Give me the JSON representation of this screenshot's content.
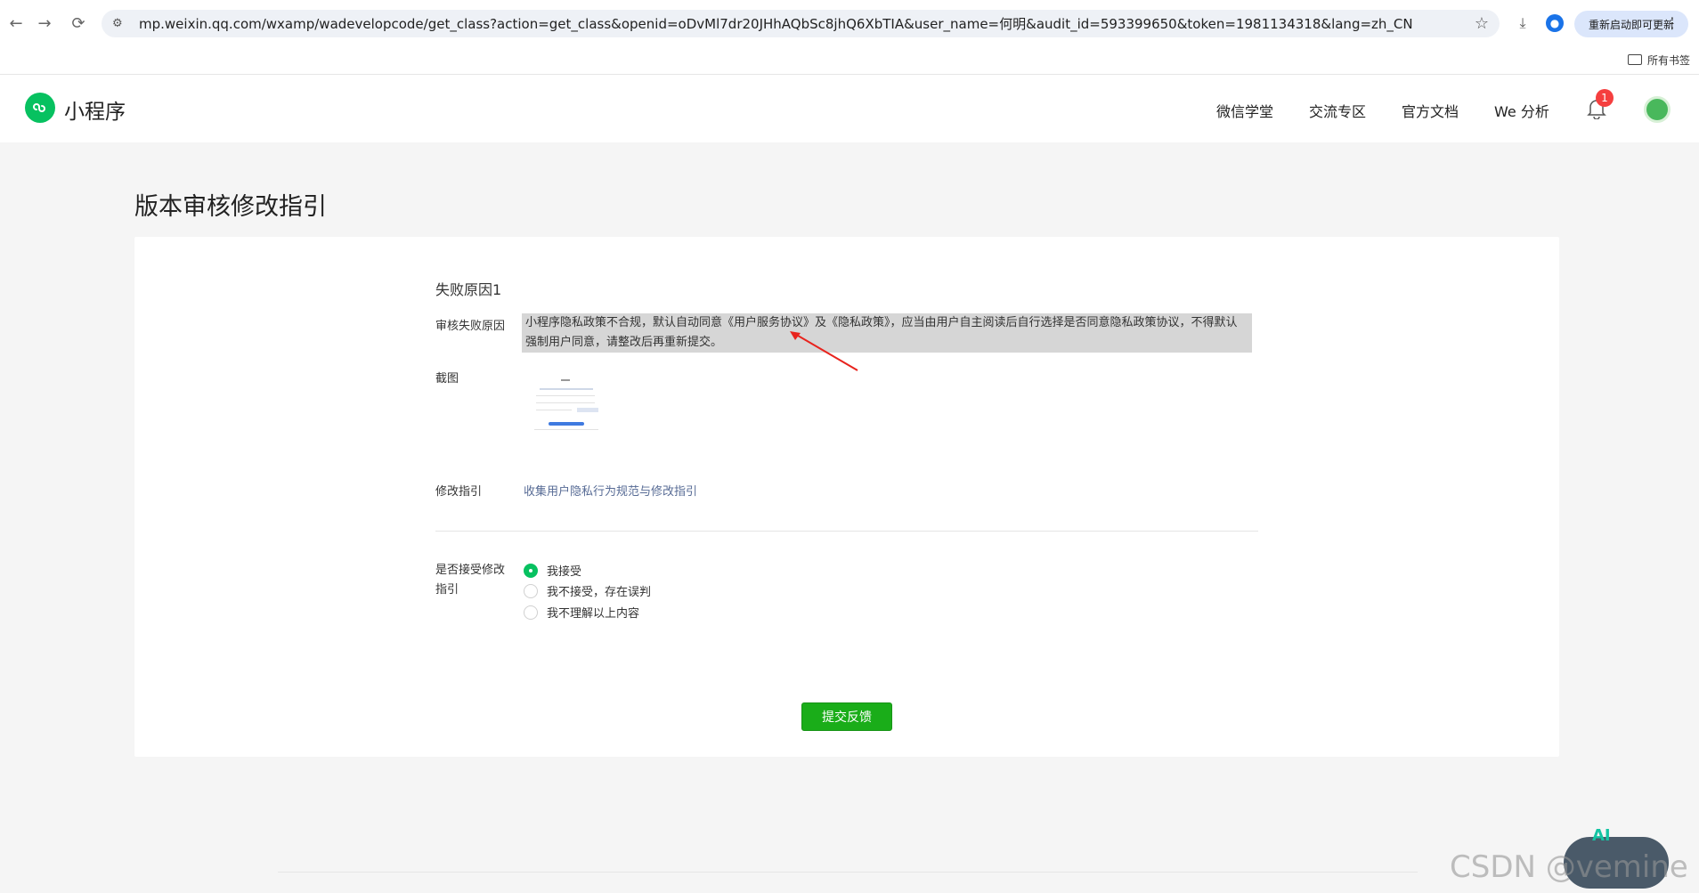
{
  "browser": {
    "url": "mp.weixin.qq.com/wxamp/wadevelopcode/get_class?action=get_class&openid=oDvMl7dr20JHhAQbSc8jhQ6XbTIA&user_name=何明&audit_id=593399650&token=1981134318&lang=zh_CN",
    "update_label": "重新启动即可更新",
    "bookmarks_label": "所有书签"
  },
  "app": {
    "logo_text": "小程序",
    "nav": [
      "微信学堂",
      "交流专区",
      "官方文档",
      "We 分析"
    ],
    "notification_count": "1"
  },
  "page": {
    "title": "版本审核修改指引",
    "section_title": "失败原因1",
    "reason_label": "审核失败原因",
    "reason_text": "小程序隐私政策不合规，默认自动同意《用户服务协议》及《隐私政策》，应当由用户自主阅读后自行选择是否同意隐私政策协议，不得默认强制用户同意，请整改后再重新提交。",
    "screenshot_label": "截图",
    "guide_label": "修改指引",
    "guide_link": "收集用户隐私行为规范与修改指引",
    "accept_label_line1": "是否接受修改",
    "accept_label_line2": "指引",
    "options": [
      "我接受",
      "我不接受，存在误判",
      "我不理解以上内容"
    ],
    "submit_label": "提交反馈"
  },
  "overlay": {
    "watermark": "CSDN @vemine",
    "ai_badge": "AI"
  },
  "colors": {
    "brand_green": "#07c160",
    "submit_green": "#1aad19",
    "link_blue": "#576b95",
    "badge_red": "#f53f3f",
    "highlight_gray": "#d6d6d6"
  }
}
